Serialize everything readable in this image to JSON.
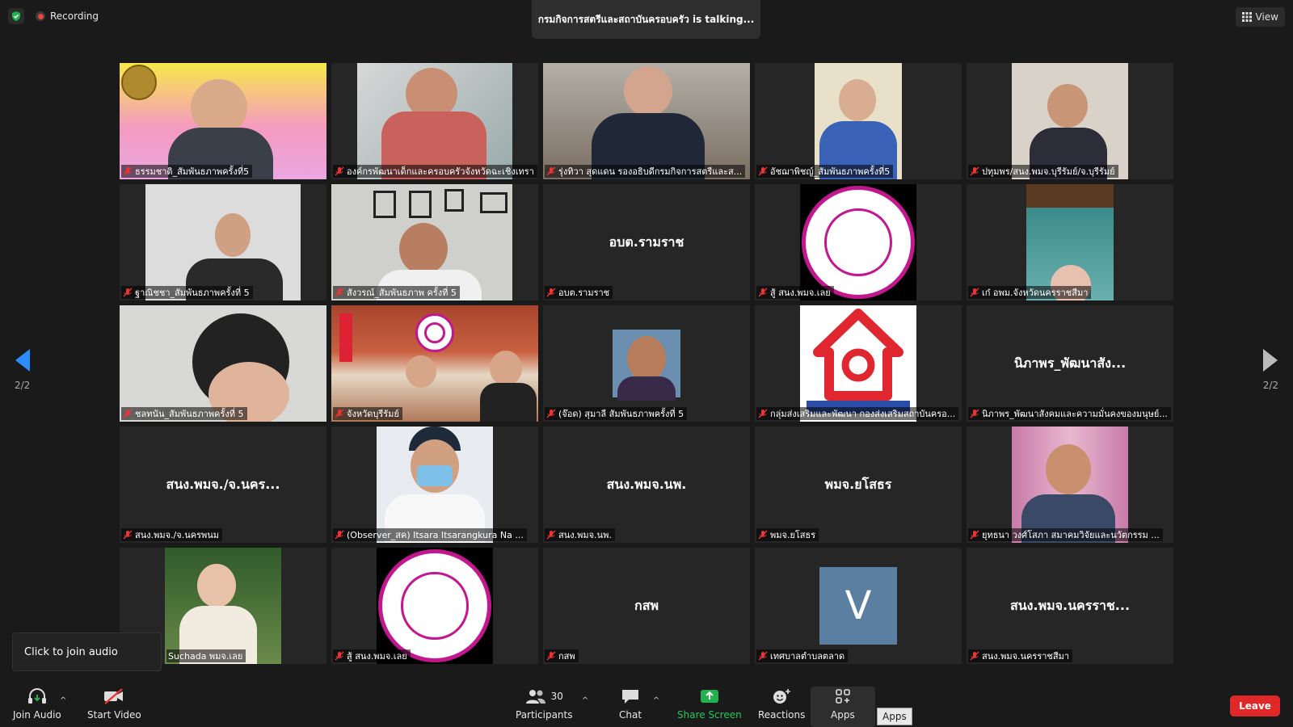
{
  "status": {
    "recording_label": "Recording",
    "talking": "กรมกิจการสตรีและสถาบันครอบครัว is talking...",
    "view_label": "View"
  },
  "pages": {
    "left": "2/2",
    "right": "2/2"
  },
  "tooltip": "Click to join audio",
  "toolbar": {
    "join_audio": "Join Audio",
    "start_video": "Start Video",
    "participants": "Participants",
    "participants_count": "30",
    "chat": "Chat",
    "share_screen": "Share Screen",
    "reactions": "Reactions",
    "apps": "Apps",
    "apps_tooltip": "Apps",
    "leave": "Leave"
  },
  "tiles": [
    {
      "label": "ธรรมชาติ_สัมพันธภาพครั้งที่5",
      "big": ""
    },
    {
      "label": "องค์กรพัฒนาเด็กและครอบครัวจังหวัดฉะเชิงเทรา",
      "big": ""
    },
    {
      "label": "รุ่งทิวา สุดแดน รองอธิบดีกรมกิจการสตรีและส...",
      "big": ""
    },
    {
      "label": "อัชฌาพิชญ์_สัมพันธภาพครั้งที่5",
      "big": ""
    },
    {
      "label": "ปทุมพร/สนง.พมจ.บุรีรัมย์/จ.บุรีรัมย์",
      "big": ""
    },
    {
      "label": "ฐาณิชชา_สัมพันธภาพครั้งที่ 5",
      "big": ""
    },
    {
      "label": "สังวรณ์_สัมพันธภาพ ครั้งที่ 5",
      "big": ""
    },
    {
      "label": "อบต.รามราช",
      "big": "อบต.รามราช"
    },
    {
      "label": "สู้ สนง.พมจ.เลย",
      "big": ""
    },
    {
      "label": "เก๋ อพม.จังหวัดนครราชสีมา",
      "big": ""
    },
    {
      "label": "ชลทนัน_สัมพันธภาพครั้งที่ 5",
      "big": ""
    },
    {
      "label": "จังหวัดบุรีรัมย์",
      "big": ""
    },
    {
      "label": "(จ๊อด) สุมาลี สัมพันธภาพครั้งที่ 5",
      "big": ""
    },
    {
      "label": "กลุ่มส่งเสริมและพัฒนา กองส่งเสริมสถาบันครอ...",
      "big": ""
    },
    {
      "label": "นิภาพร_พัฒนาสังคมและความมั่นคงของมนุษย์...",
      "big": "นิภาพร_พัฒนาสัง..."
    },
    {
      "label": "สนง.พมจ./จ.นครพนม",
      "big": "สนง.พมจ./จ.นคร..."
    },
    {
      "label": "(Observer_สค) Itsara Itsarangkura Na ...",
      "big": ""
    },
    {
      "label": "สนง.พมจ.นพ.",
      "big": "สนง.พมจ.นพ."
    },
    {
      "label": "พมจ.ยโสธร",
      "big": "พมจ.ยโสธร"
    },
    {
      "label": "ยุทธนา วงศ์โสภา สมาคมวิจัยและนวัตกรรม ...",
      "big": ""
    },
    {
      "label": "Suchada พมจ.เลย",
      "big": ""
    },
    {
      "label": "สู้ สนง.พมจ.เลย",
      "big": ""
    },
    {
      "label": "กสพ",
      "big": "กสพ"
    },
    {
      "label": "เทศบาลตำบลตลาด",
      "big": "",
      "avatar": "V"
    },
    {
      "label": "สนง.พมจ.นครราชสีมา",
      "big": "สนง.พมจ.นครราช..."
    }
  ]
}
